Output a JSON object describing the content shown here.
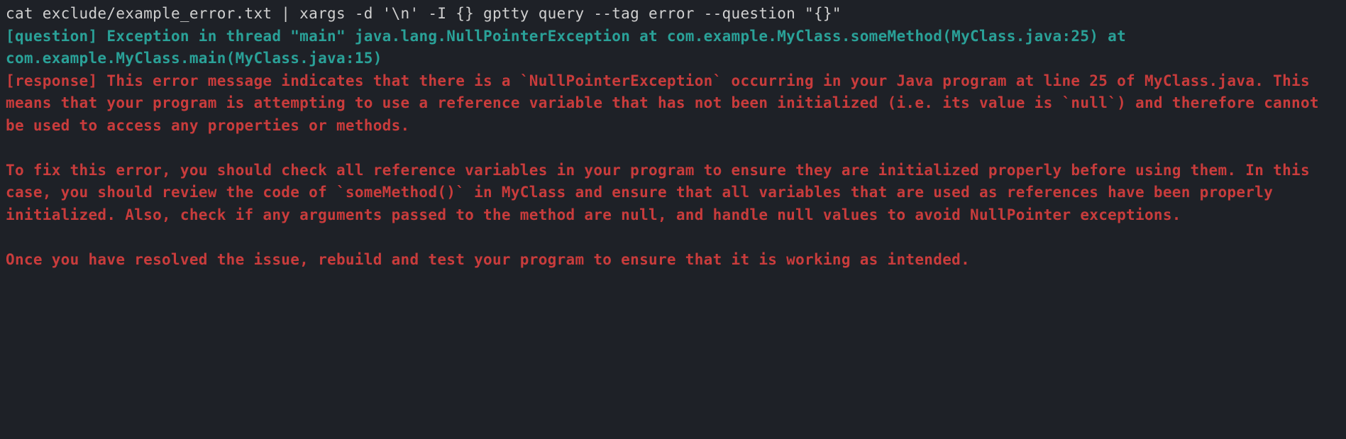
{
  "terminal": {
    "command": "cat exclude/example_error.txt | xargs -d '\\n' -I {} gptty query --tag error --question \"{}\"",
    "question": {
      "label": "[question]",
      "text": " Exception in thread \"main\" java.lang.NullPointerException at com.example.MyClass.someMethod(MyClass.java:25) at com.example.MyClass.main(MyClass.java:15)"
    },
    "response": {
      "label": "[response]",
      "text": " This error message indicates that there is a `NullPointerException` occurring in your Java program at line 25 of MyClass.java. This means that your program is attempting to use a reference variable that has not been initialized (i.e. its value is `null`) and therefore cannot be used to access any properties or methods.\n\nTo fix this error, you should check all reference variables in your program to ensure they are initialized properly before using them. In this case, you should review the code of `someMethod()` in MyClass and ensure that all variables that are used as references have been properly initialized. Also, check if any arguments passed to the method are null, and handle null values to avoid NullPointer exceptions.\n\nOnce you have resolved the issue, rebuild and test your program to ensure that it is working as intended."
    }
  }
}
